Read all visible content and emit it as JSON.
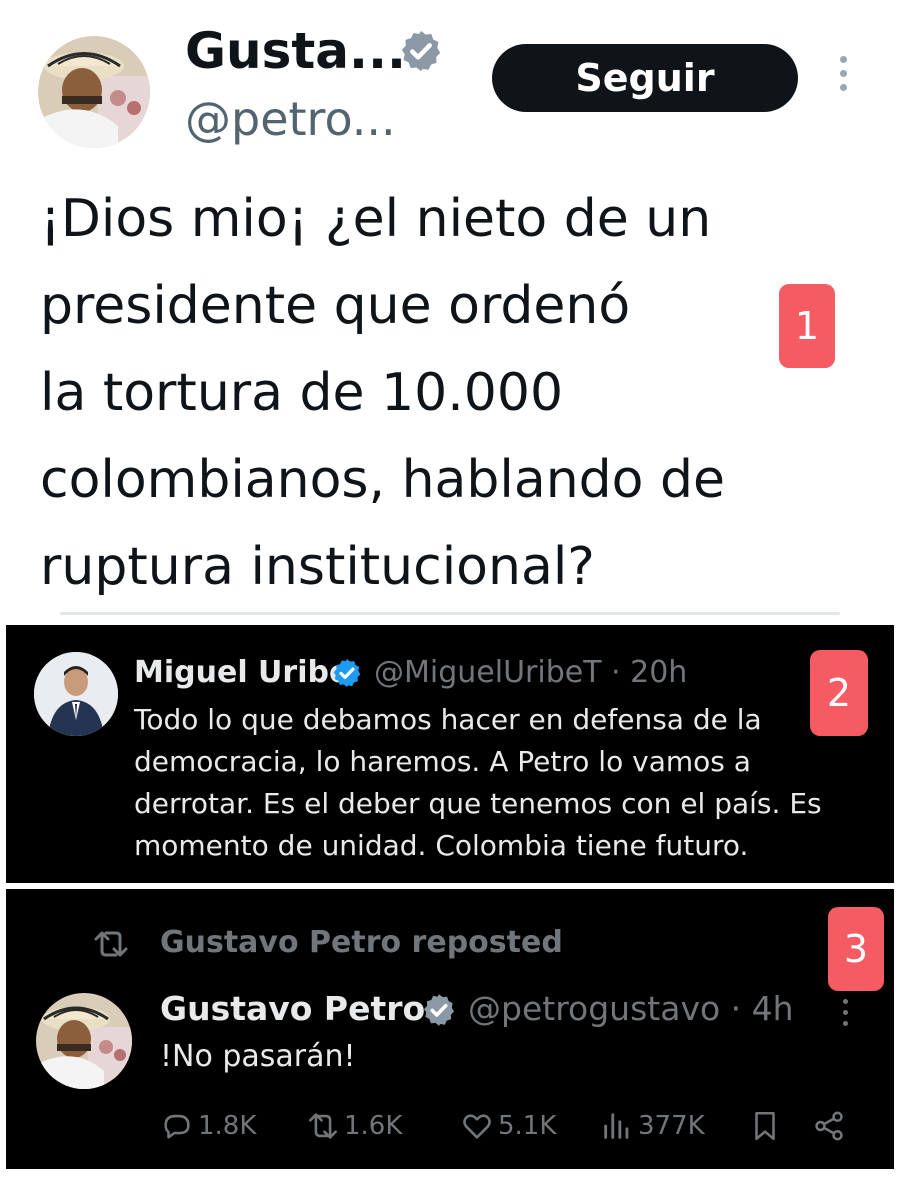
{
  "panel1": {
    "name": "Gusta...",
    "handle": "@petro...",
    "follow_label": "Seguir",
    "tweet_lines": [
      "¡Dios mio¡ ¿el nieto de un",
      "presidente que ordenó",
      "la tortura de 10.000",
      "colombianos, hablando de",
      "ruptura institucional?"
    ],
    "badge_number": "1"
  },
  "panel2": {
    "name": "Miguel Uribe",
    "meta": "@MiguelUribeT · 20h",
    "tweet_lines": [
      "Todo lo que debamos hacer en defensa de la",
      "democracia, lo haremos. A Petro lo vamos a",
      "derrotar. Es el deber que tenemos con el país. Es",
      "momento de unidad. Colombia tiene futuro."
    ],
    "badge_number": "2"
  },
  "panel3": {
    "repost_label": "Gustavo Petro reposted",
    "name": "Gustavo Petro",
    "meta": "@petrogustavo · 4h",
    "tweet_text": "!No pasarán!",
    "badge_number": "3",
    "actions": {
      "replies": "1.8K",
      "reposts": "1.6K",
      "likes": "5.1K",
      "views": "377K"
    },
    "icons": [
      "reply-icon",
      "repost-icon",
      "like-icon",
      "views-icon",
      "bookmark-icon",
      "share-icon"
    ]
  },
  "colors": {
    "verified_light": "#8b98a5",
    "verified_dark": "#1d9bf0",
    "badge_red": "#f45b62",
    "dark_bg": "#000000"
  }
}
